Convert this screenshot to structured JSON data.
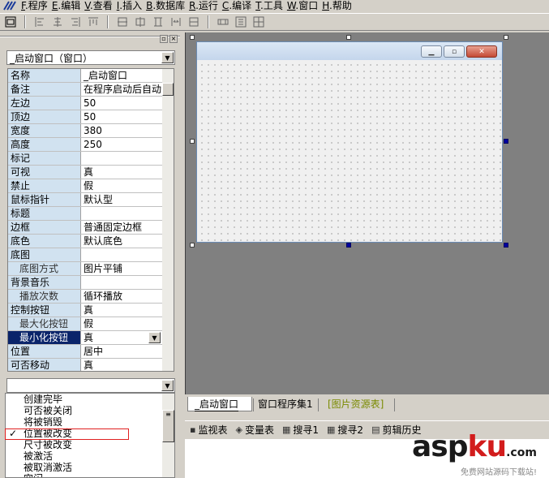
{
  "menubar": {
    "items": [
      {
        "key": "F",
        "label": ".程序"
      },
      {
        "key": "E",
        "label": ".编辑"
      },
      {
        "key": "V",
        "label": ".查看"
      },
      {
        "key": "I",
        "label": ".插入"
      },
      {
        "key": "B",
        "label": ".数据库"
      },
      {
        "key": "R",
        "label": ".运行"
      },
      {
        "key": "C",
        "label": ".编译"
      },
      {
        "key": "T",
        "label": ".工具"
      },
      {
        "key": "W",
        "label": ".窗口"
      },
      {
        "key": "H",
        "label": ".帮助"
      }
    ]
  },
  "property_panel": {
    "object_select": "_启动窗口（窗口）",
    "rows": [
      {
        "name": "名称",
        "value": "_启动窗口",
        "sub": false
      },
      {
        "name": "备注",
        "value": "在程序启动后自动",
        "sub": false
      },
      {
        "name": "左边",
        "value": "50",
        "sub": false
      },
      {
        "name": "顶边",
        "value": "50",
        "sub": false
      },
      {
        "name": "宽度",
        "value": "380",
        "sub": false
      },
      {
        "name": "高度",
        "value": "250",
        "sub": false
      },
      {
        "name": "标记",
        "value": "",
        "sub": false
      },
      {
        "name": "可视",
        "value": "真",
        "sub": false
      },
      {
        "name": "禁止",
        "value": "假",
        "sub": false
      },
      {
        "name": "鼠标指针",
        "value": "默认型",
        "sub": false
      },
      {
        "name": "标题",
        "value": "",
        "sub": false
      },
      {
        "name": "边框",
        "value": "普通固定边框",
        "sub": false
      },
      {
        "name": "底色",
        "value": "默认底色",
        "sub": false
      },
      {
        "name": "底图",
        "value": "",
        "sub": false
      },
      {
        "name": "底图方式",
        "value": "图片平铺",
        "sub": true
      },
      {
        "name": "背景音乐",
        "value": "",
        "sub": false
      },
      {
        "name": "播放次数",
        "value": "循环播放",
        "sub": true
      },
      {
        "name": "控制按钮",
        "value": "真",
        "sub": false
      },
      {
        "name": "最大化按钮",
        "value": "假",
        "sub": true
      },
      {
        "name": "最小化按钮",
        "value": "真",
        "sub": true,
        "selected": true
      },
      {
        "name": "位置",
        "value": "居中",
        "sub": false
      },
      {
        "name": "可否移动",
        "value": "真",
        "sub": false
      }
    ]
  },
  "event_list": {
    "items": [
      {
        "label": "创建完毕",
        "checked": false
      },
      {
        "label": "可否被关闭",
        "checked": false
      },
      {
        "label": "将被销毁",
        "checked": false
      },
      {
        "label": "位置被改变",
        "checked": true
      },
      {
        "label": "尺寸被改变",
        "checked": false
      },
      {
        "label": "被激活",
        "checked": false
      },
      {
        "label": "被取消激活",
        "checked": false
      },
      {
        "label": "空闲",
        "checked": false
      }
    ],
    "check_mark": "✓"
  },
  "tabs": {
    "items": [
      "_启动窗口",
      "窗口程序集1",
      "[图片资源表]"
    ]
  },
  "bottom_tools": {
    "items": [
      "监视表",
      "变量表",
      "搜寻1",
      "搜寻2",
      "剪辑历史"
    ]
  },
  "watermark": {
    "text_a": "asp",
    "text_b": "ku",
    "text_c": ".com",
    "sub": "免费网站源码下载站!"
  }
}
